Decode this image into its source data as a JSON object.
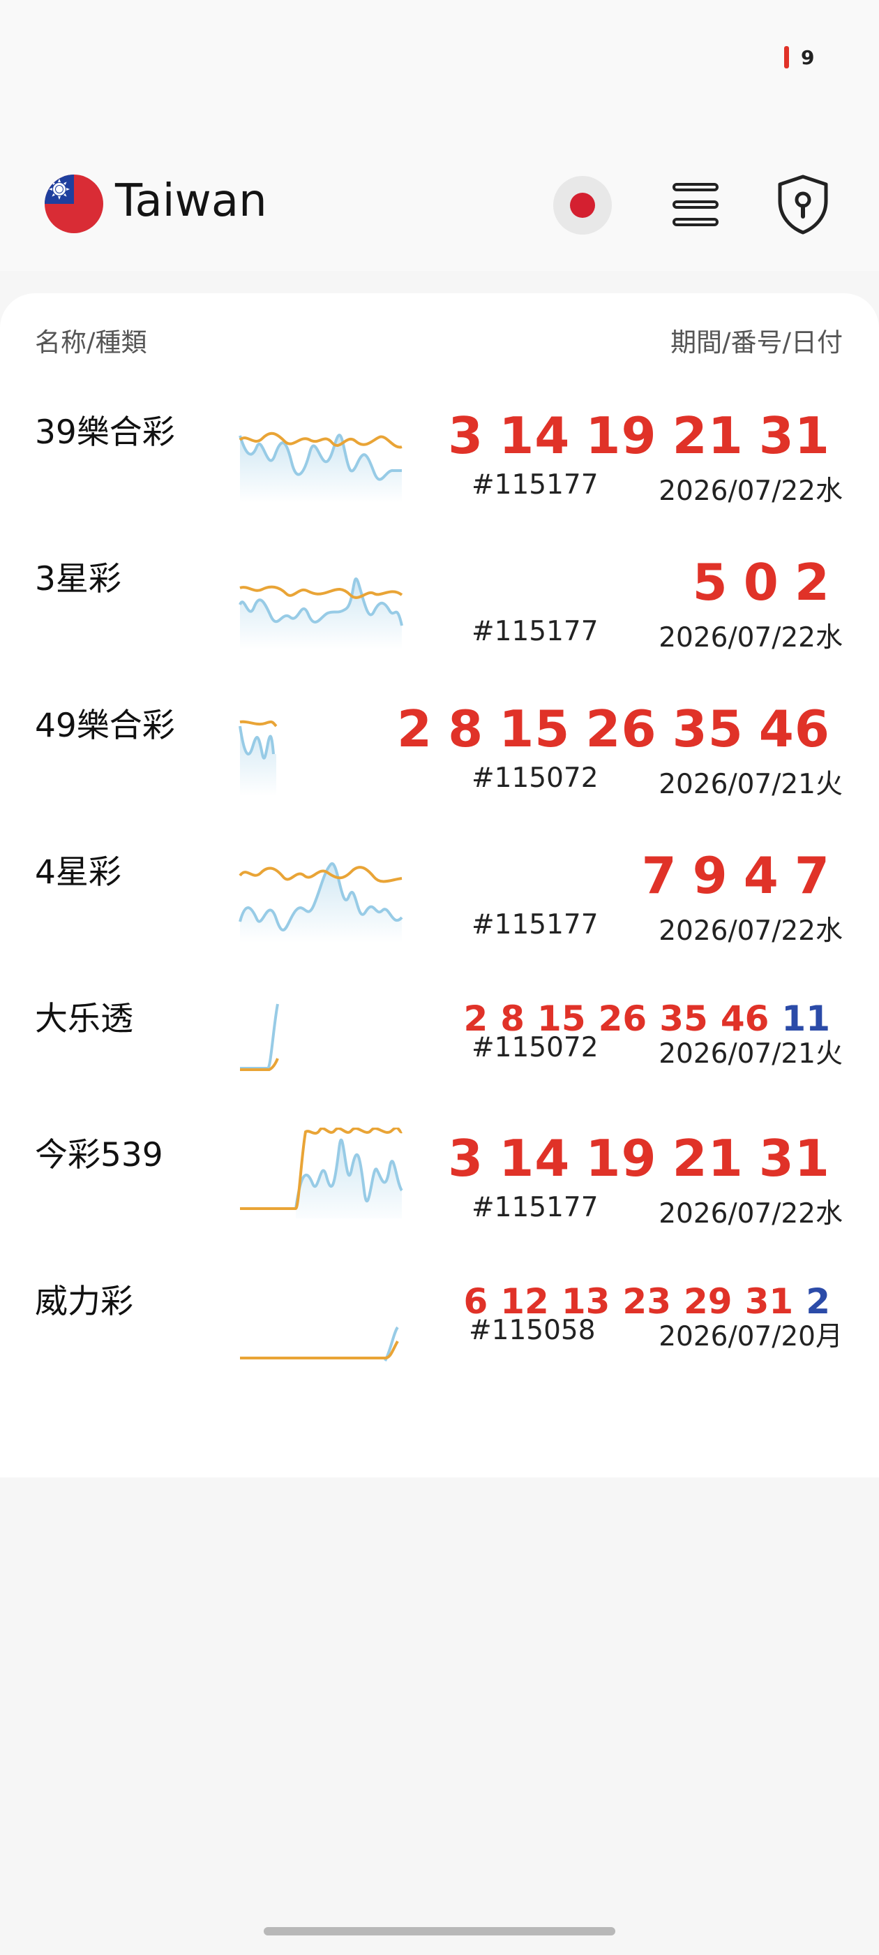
{
  "status_bar": {
    "battery_level": "9"
  },
  "header": {
    "title": "Taiwan"
  },
  "columns": {
    "left": "名称/種類",
    "right": "期間/番号/日付"
  },
  "colors": {
    "number_red": "#e03228",
    "bonus_blue": "#2b4ba8",
    "line_blue": "#97cbe6",
    "line_orange": "#e9a436"
  },
  "lotteries": [
    {
      "name": "39樂合彩",
      "numbers": [
        "3",
        "14",
        "19",
        "21",
        "31"
      ],
      "bonus": "",
      "period": "#115177",
      "date": "2026/07/22水"
    },
    {
      "name": "3星彩",
      "numbers": [
        "5",
        "0",
        "2"
      ],
      "bonus": "",
      "period": "#115177",
      "date": "2026/07/22水"
    },
    {
      "name": "49樂合彩",
      "numbers": [
        "2",
        "8",
        "15",
        "26",
        "35",
        "46"
      ],
      "bonus": "",
      "period": "#115072",
      "date": "2026/07/21火"
    },
    {
      "name": "4星彩",
      "numbers": [
        "7",
        "9",
        "4",
        "7"
      ],
      "bonus": "",
      "period": "#115177",
      "date": "2026/07/22水"
    },
    {
      "name": "大乐透",
      "numbers": [
        "2",
        "8",
        "15",
        "26",
        "35",
        "46"
      ],
      "bonus": "11",
      "period": "#115072",
      "date": "2026/07/21火"
    },
    {
      "name": "今彩539",
      "numbers": [
        "3",
        "14",
        "19",
        "21",
        "31"
      ],
      "bonus": "",
      "period": "#115177",
      "date": "2026/07/22水"
    },
    {
      "name": "威力彩",
      "numbers": [
        "6",
        "12",
        "13",
        "23",
        "29",
        "31"
      ],
      "bonus": "2",
      "period": "#115058",
      "date": "2026/07/20月"
    }
  ]
}
